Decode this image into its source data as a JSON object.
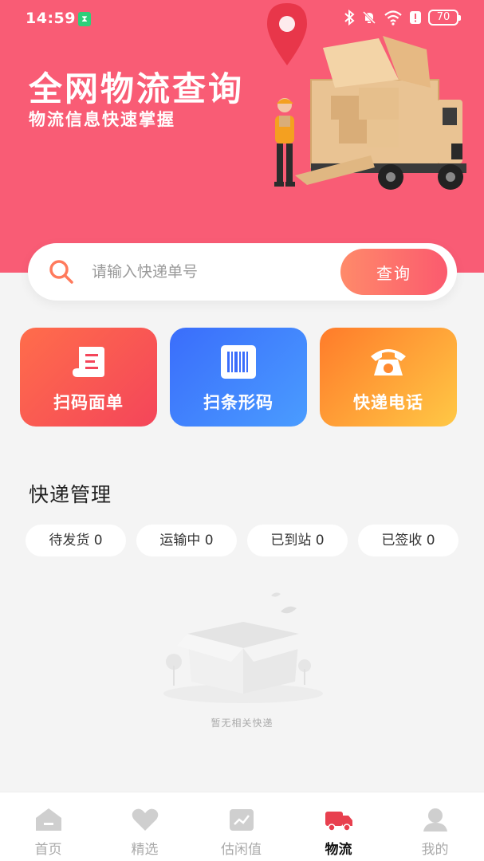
{
  "status_bar": {
    "time": "14:59",
    "battery": "70",
    "icons": [
      "bluetooth-icon",
      "mute-icon",
      "wifi-icon",
      "alert-icon",
      "battery-icon"
    ]
  },
  "hero": {
    "title": "全网物流查询",
    "subtitle": "物流信息快速掌握",
    "background_color": "#f95c75"
  },
  "search": {
    "placeholder": "请输入快递单号",
    "value": "",
    "button_label": "查询"
  },
  "quick_actions": [
    {
      "label": "扫码面单",
      "icon": "waybill-icon"
    },
    {
      "label": "扫条形码",
      "icon": "barcode-icon"
    },
    {
      "label": "快递电话",
      "icon": "telephone-icon"
    }
  ],
  "management": {
    "title": "快递管理",
    "statuses": [
      {
        "label": "待发货 0"
      },
      {
        "label": "运输中 0"
      },
      {
        "label": "已到站 0"
      },
      {
        "label": "已签收 0"
      }
    ]
  },
  "empty_state": {
    "text": "暂无相关快递",
    "icon": "empty-box-icon"
  },
  "tab_bar": {
    "active_index": 3,
    "active_color": "#e8404f",
    "items": [
      {
        "label": "首页",
        "icon": "home-icon"
      },
      {
        "label": "精选",
        "icon": "heart-icon"
      },
      {
        "label": "估闲值",
        "icon": "chart-icon"
      },
      {
        "label": "物流",
        "icon": "truck-icon"
      },
      {
        "label": "我的",
        "icon": "user-icon"
      }
    ]
  }
}
